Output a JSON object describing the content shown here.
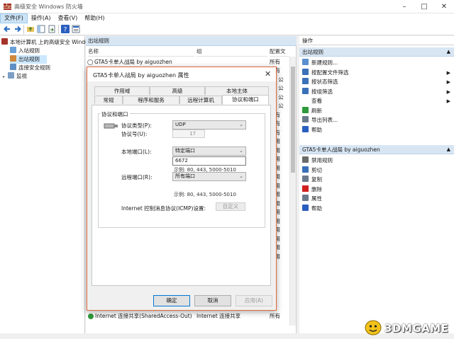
{
  "window": {
    "title": "高级安全 Windows 防火墙",
    "app_icon": "firewall-shield-icon",
    "controls": [
      "minimize",
      "maximize",
      "close"
    ]
  },
  "menu": [
    "文件(F)",
    "操作(A)",
    "查看(V)",
    "帮助(H)"
  ],
  "toolbar_icons": [
    "back-arrow-icon",
    "forward-arrow-icon",
    "up-folder-icon",
    "show-hide-tree-icon",
    "export-icon",
    "help-icon",
    "properties-icon"
  ],
  "tree": {
    "root": "本地计算机 上的高级安全 Windo",
    "items": [
      "入站规则",
      "出站规则",
      "连接安全规则",
      "监视"
    ]
  },
  "center": {
    "header": "出站规则",
    "columns": [
      "名称",
      "组",
      "配置文"
    ],
    "top_row": {
      "name": "GTA5卡单人战局 by aiguozhen",
      "group": "",
      "profile": "所有"
    },
    "right_col_values": [
      "所有",
      "域, 公",
      "域, 公",
      "域, 公",
      "域, 公",
      "所有",
      "所有",
      "所有",
      "专用",
      "专用",
      "专用",
      "专用",
      "专用",
      "专用",
      "专用",
      "专用",
      "专用",
      "专用",
      "专用",
      "专用",
      "专用",
      "专用"
    ],
    "bottom_row": {
      "name": "Internet 连接共享(SharedAccess-Out)",
      "group": "Internet 连接共享",
      "profile": "所有"
    }
  },
  "actions": {
    "header": "操作",
    "section1": {
      "title": "出站规则",
      "items": [
        {
          "label": "新建规则...",
          "icon": "new-rule-icon",
          "submenu": false
        },
        {
          "label": "按配置文件筛选",
          "icon": "filter-icon",
          "submenu": true
        },
        {
          "label": "按状态筛选",
          "icon": "filter-icon",
          "submenu": true
        },
        {
          "label": "按组筛选",
          "icon": "filter-icon",
          "submenu": true
        },
        {
          "label": "查看",
          "icon": "",
          "submenu": true
        },
        {
          "label": "刷新",
          "icon": "refresh-icon",
          "submenu": false
        },
        {
          "label": "导出列表...",
          "icon": "export-list-icon",
          "submenu": false
        },
        {
          "label": "帮助",
          "icon": "help-icon",
          "submenu": false
        }
      ]
    },
    "section2": {
      "title": "GTA5卡单人战局 by aiguozhen",
      "items": [
        {
          "label": "禁用规则",
          "icon": "disable-rule-icon"
        },
        {
          "label": "剪切",
          "icon": "cut-icon"
        },
        {
          "label": "复制",
          "icon": "copy-icon"
        },
        {
          "label": "删除",
          "icon": "delete-icon"
        },
        {
          "label": "属性",
          "icon": "properties-icon"
        },
        {
          "label": "帮助",
          "icon": "help-icon"
        }
      ]
    }
  },
  "dialog": {
    "title": "GTA5卡单人战局 by aiguozhen 属性",
    "tabs_row1": [
      "作用域",
      "高级",
      "本地主体"
    ],
    "tabs_row2": [
      "常规",
      "程序和服务",
      "远程计算机",
      "协议和端口"
    ],
    "active_tab": "协议和端口",
    "group_title": "协议和端口",
    "protocol_type_label": "协议类型(P):",
    "protocol_type_value": "UDP",
    "protocol_number_label": "协议号(U):",
    "protocol_number_value": "17",
    "local_port_label": "本地端口(L):",
    "local_port_select": "特定端口",
    "local_port_value": "6672",
    "local_port_example": "示例: 80, 443, 5000-5010",
    "remote_port_label": "远程端口(R):",
    "remote_port_select": "所有端口",
    "remote_port_example": "示例: 80, 443, 5000-5010",
    "icmp_label": "Internet 控制消息协议(ICMP)设置:",
    "icmp_button": "自定义",
    "ok": "确定",
    "cancel": "取消",
    "apply": "应用(A)"
  },
  "watermark": {
    "text": "3DMGAME",
    "emblem": "3dm-logo-icon"
  }
}
